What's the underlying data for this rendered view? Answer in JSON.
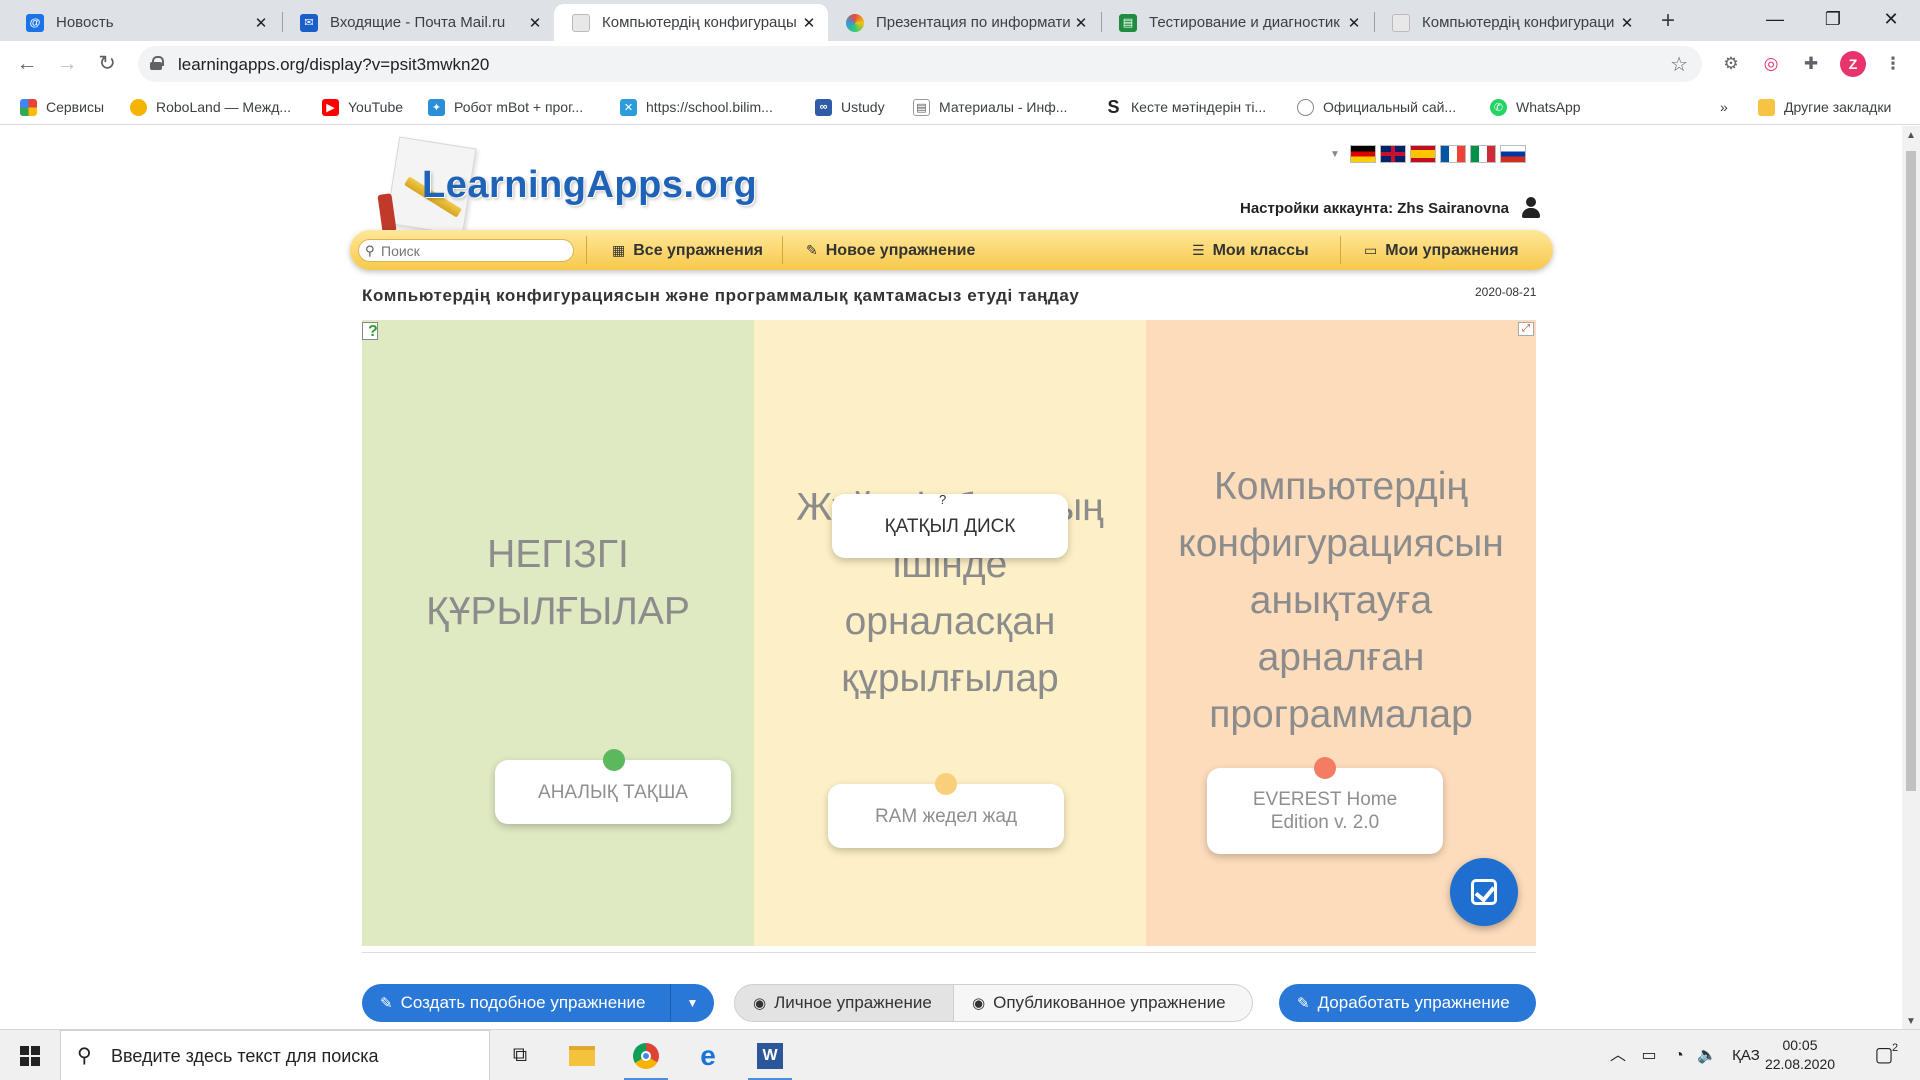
{
  "browser": {
    "tabs": [
      {
        "title": "Новость",
        "active": false,
        "favicon": "mail-at-icon"
      },
      {
        "title": "Входящие - Почта Mail.ru",
        "active": false,
        "favicon": "mail-envelope-icon"
      },
      {
        "title": "Компьютердің конфигурацы",
        "active": true,
        "favicon": "learningapps-icon"
      },
      {
        "title": "Презентация по информати",
        "active": false,
        "favicon": "pinwheel-icon"
      },
      {
        "title": "Тестирование и диагностик",
        "active": false,
        "favicon": "document-icon"
      },
      {
        "title": "Компьютердің конфигураци",
        "active": false,
        "favicon": "learningapps-icon"
      }
    ],
    "url": "learningapps.org/display?v=psit3mwkn20",
    "profile_letter": "Z",
    "bookmarks": [
      {
        "label": "Сервисы",
        "icon": "apps-grid-icon"
      },
      {
        "label": "RoboLand — Межд...",
        "icon": "roboland-icon"
      },
      {
        "label": "YouTube",
        "icon": "youtube-icon"
      },
      {
        "label": "Робот mBot + прог...",
        "icon": "robot-icon"
      },
      {
        "label": "https://school.bilim...",
        "icon": "bilim-icon"
      },
      {
        "label": "Ustudy",
        "icon": "ustudy-icon"
      },
      {
        "label": "Материалы - Инф...",
        "icon": "document-icon"
      },
      {
        "label": "Кесте мәтіндерін ті...",
        "icon": "s-logo-icon"
      },
      {
        "label": "Официальный сай...",
        "icon": "globe-icon"
      },
      {
        "label": "WhatsApp",
        "icon": "whatsapp-icon"
      }
    ],
    "bookmarks_overflow": "»",
    "other_bookmarks": "Другие закладки"
  },
  "site": {
    "logo_text": "LearningApps.org",
    "account_label": "Настройки аккаунта: Zhs Sairanovna",
    "search_placeholder": "Поиск",
    "nav": {
      "all_exercises": "Все упражнения",
      "new_exercise": "Новое упражнение",
      "my_classes": "Мои классы",
      "my_exercises": "Мои упражнения"
    },
    "languages": [
      "de",
      "en",
      "es",
      "fr",
      "it",
      "ru"
    ]
  },
  "exercise": {
    "title": "Компьютердің конфигурациясын және программалық қамтамасыз етуді таңдау",
    "date": "2020-08-21",
    "columns": [
      {
        "label": "НЕГІЗГІ ҚҰРЫЛҒЫЛАР",
        "color": "#dfe9c2",
        "dot_color": "#5cb85c"
      },
      {
        "label": "Жүйелік блоктың ішінде орналасқан құрылғылар",
        "color": "#fdf0c6",
        "dot_color": "#f9cf7c"
      },
      {
        "label": "Компьютердің конфигурациясын анықтауға арналған программалар",
        "color": "#fcdcbb",
        "dot_color": "#f47c63"
      }
    ],
    "cards": [
      {
        "text": "ҚАТҚЫЛ ДИСК"
      },
      {
        "text": "АНАЛЫҚ ТАҚША"
      },
      {
        "text": "RAM жедел жад"
      },
      {
        "text": "EVEREST Home Edition v. 2.0"
      }
    ],
    "card_hint": "?"
  },
  "actions": {
    "create_similar": "Создать подобное упражнение",
    "private": "Личное упражнение",
    "published": "Опубликованное упражнение",
    "edit": "Доработать упражнение"
  },
  "taskbar": {
    "search_placeholder": "Введите здесь текст для поиска",
    "language": "ҚАЗ",
    "time": "00:05",
    "date": "22.08.2020",
    "notifications": "2"
  }
}
